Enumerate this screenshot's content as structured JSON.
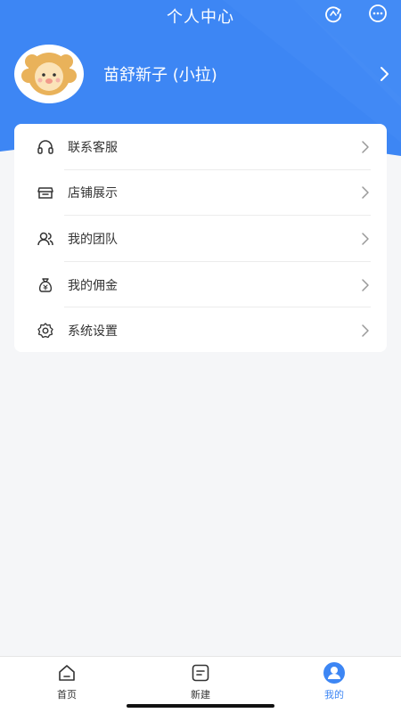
{
  "header": {
    "title": "个人中心",
    "icons": [
      "refresh-icon",
      "more-icon"
    ]
  },
  "profile": {
    "username": "苗舒新子 (小拉)",
    "avatar_icon": "lion-avatar"
  },
  "menu": {
    "items": [
      {
        "label": "联系客服",
        "icon": "headset-icon"
      },
      {
        "label": "店铺展示",
        "icon": "store-icon"
      },
      {
        "label": "我的团队",
        "icon": "team-icon"
      },
      {
        "label": "我的佣金",
        "icon": "money-bag-icon"
      },
      {
        "label": "系统设置",
        "icon": "settings-icon"
      }
    ]
  },
  "tabbar": {
    "tabs": [
      {
        "label": "首页",
        "icon": "home-icon",
        "active": false
      },
      {
        "label": "新建",
        "icon": "new-doc-icon",
        "active": false
      },
      {
        "label": "我的",
        "icon": "user-icon",
        "active": true
      }
    ]
  },
  "colors": {
    "accent": "#3d86f4",
    "background": "#f5f6f8"
  }
}
